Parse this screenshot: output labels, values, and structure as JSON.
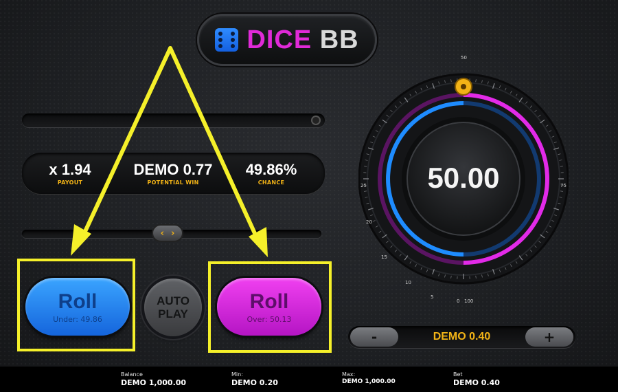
{
  "logo": {
    "word1": "DICE",
    "word2": "BB"
  },
  "stats": {
    "payout_value": "x 1.94",
    "payout_label": "PAYOUT",
    "win_value": "DEMO 0.77",
    "win_label": "POTENTIAL WIN",
    "chance_value": "49.86%",
    "chance_label": "CHANCE"
  },
  "roll_under": {
    "title": "Roll",
    "sub": "Under: 49.86"
  },
  "roll_over": {
    "title": "Roll",
    "sub": "Over: 50.13"
  },
  "auto_play": {
    "line1": "AUTO",
    "line2": "PLAY"
  },
  "bet_control": {
    "minus": "-",
    "plus": "+",
    "value": "DEMO 0.40"
  },
  "dial": {
    "center_value": "50.00",
    "roll_value": 50,
    "scale_labels": [
      "50",
      "75",
      "25",
      "20",
      "15",
      "10",
      "5",
      "0",
      "100"
    ],
    "colors": {
      "under": "#1e8cff",
      "over": "#e22ae8",
      "marker": "#f2b316"
    }
  },
  "footer": {
    "balance_label": "Balance",
    "balance_value": "DEMO 1,000.00",
    "min_label": "Min:",
    "min_value": "DEMO 0.20",
    "max_label": "Max:",
    "max_value": "DEMO 1,000.00",
    "bet_label": "Bet",
    "bet_value": "DEMO 0.40"
  },
  "annotation": {
    "color": "#f5f02a"
  }
}
